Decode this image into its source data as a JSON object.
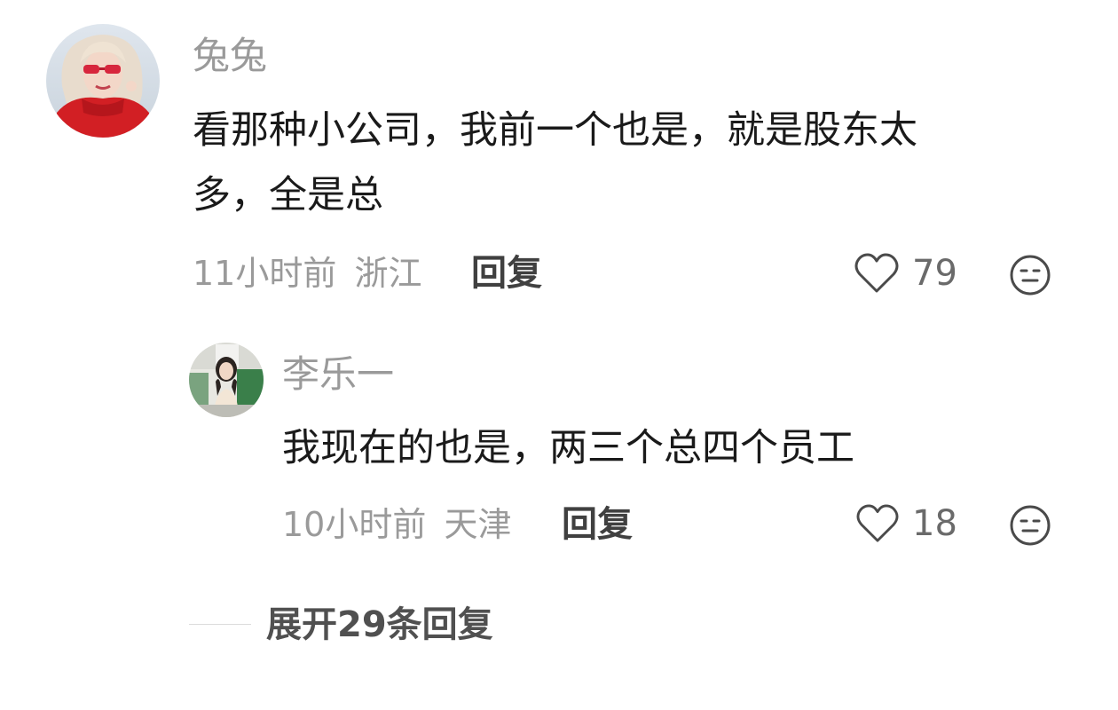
{
  "comment": {
    "username": "兔兔",
    "text_line1": "看那种小公司，我前一个也是，就是股东太",
    "text_line2": "多，全是总",
    "time": "11小时前",
    "location": "浙江",
    "reply_label": "回复",
    "likes": "79",
    "icons": {
      "like": "heart-outline-icon",
      "emoji": "neutral-face-icon"
    }
  },
  "reply": {
    "username": "李乐一",
    "text": "我现在的也是，两三个总四个员工",
    "time": "10小时前",
    "location": "天津",
    "reply_label": "回复",
    "likes": "18"
  },
  "expand": {
    "label": "展开29条回复"
  },
  "colors": {
    "meta": "#9a9a9a",
    "text": "#1a1a1a",
    "reply_button": "#404040"
  }
}
